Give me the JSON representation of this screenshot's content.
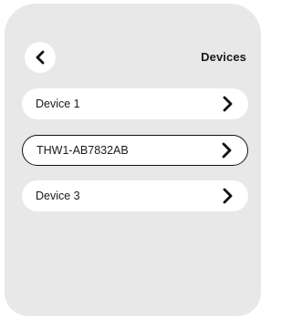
{
  "header": {
    "title": "Devices",
    "back_icon": "chevron-left-icon"
  },
  "devices": [
    {
      "label": "Device 1",
      "selected": false,
      "icon": "chevron-right-icon"
    },
    {
      "label": "THW1-AB7832AB",
      "selected": true,
      "icon": "chevron-right-icon"
    },
    {
      "label": "Device 3",
      "selected": false,
      "icon": "chevron-right-icon"
    }
  ],
  "colors": {
    "panel_background": "#e8e8e8",
    "row_background": "#ffffff",
    "text": "#1a1a1a",
    "selected_border": "#111111"
  }
}
